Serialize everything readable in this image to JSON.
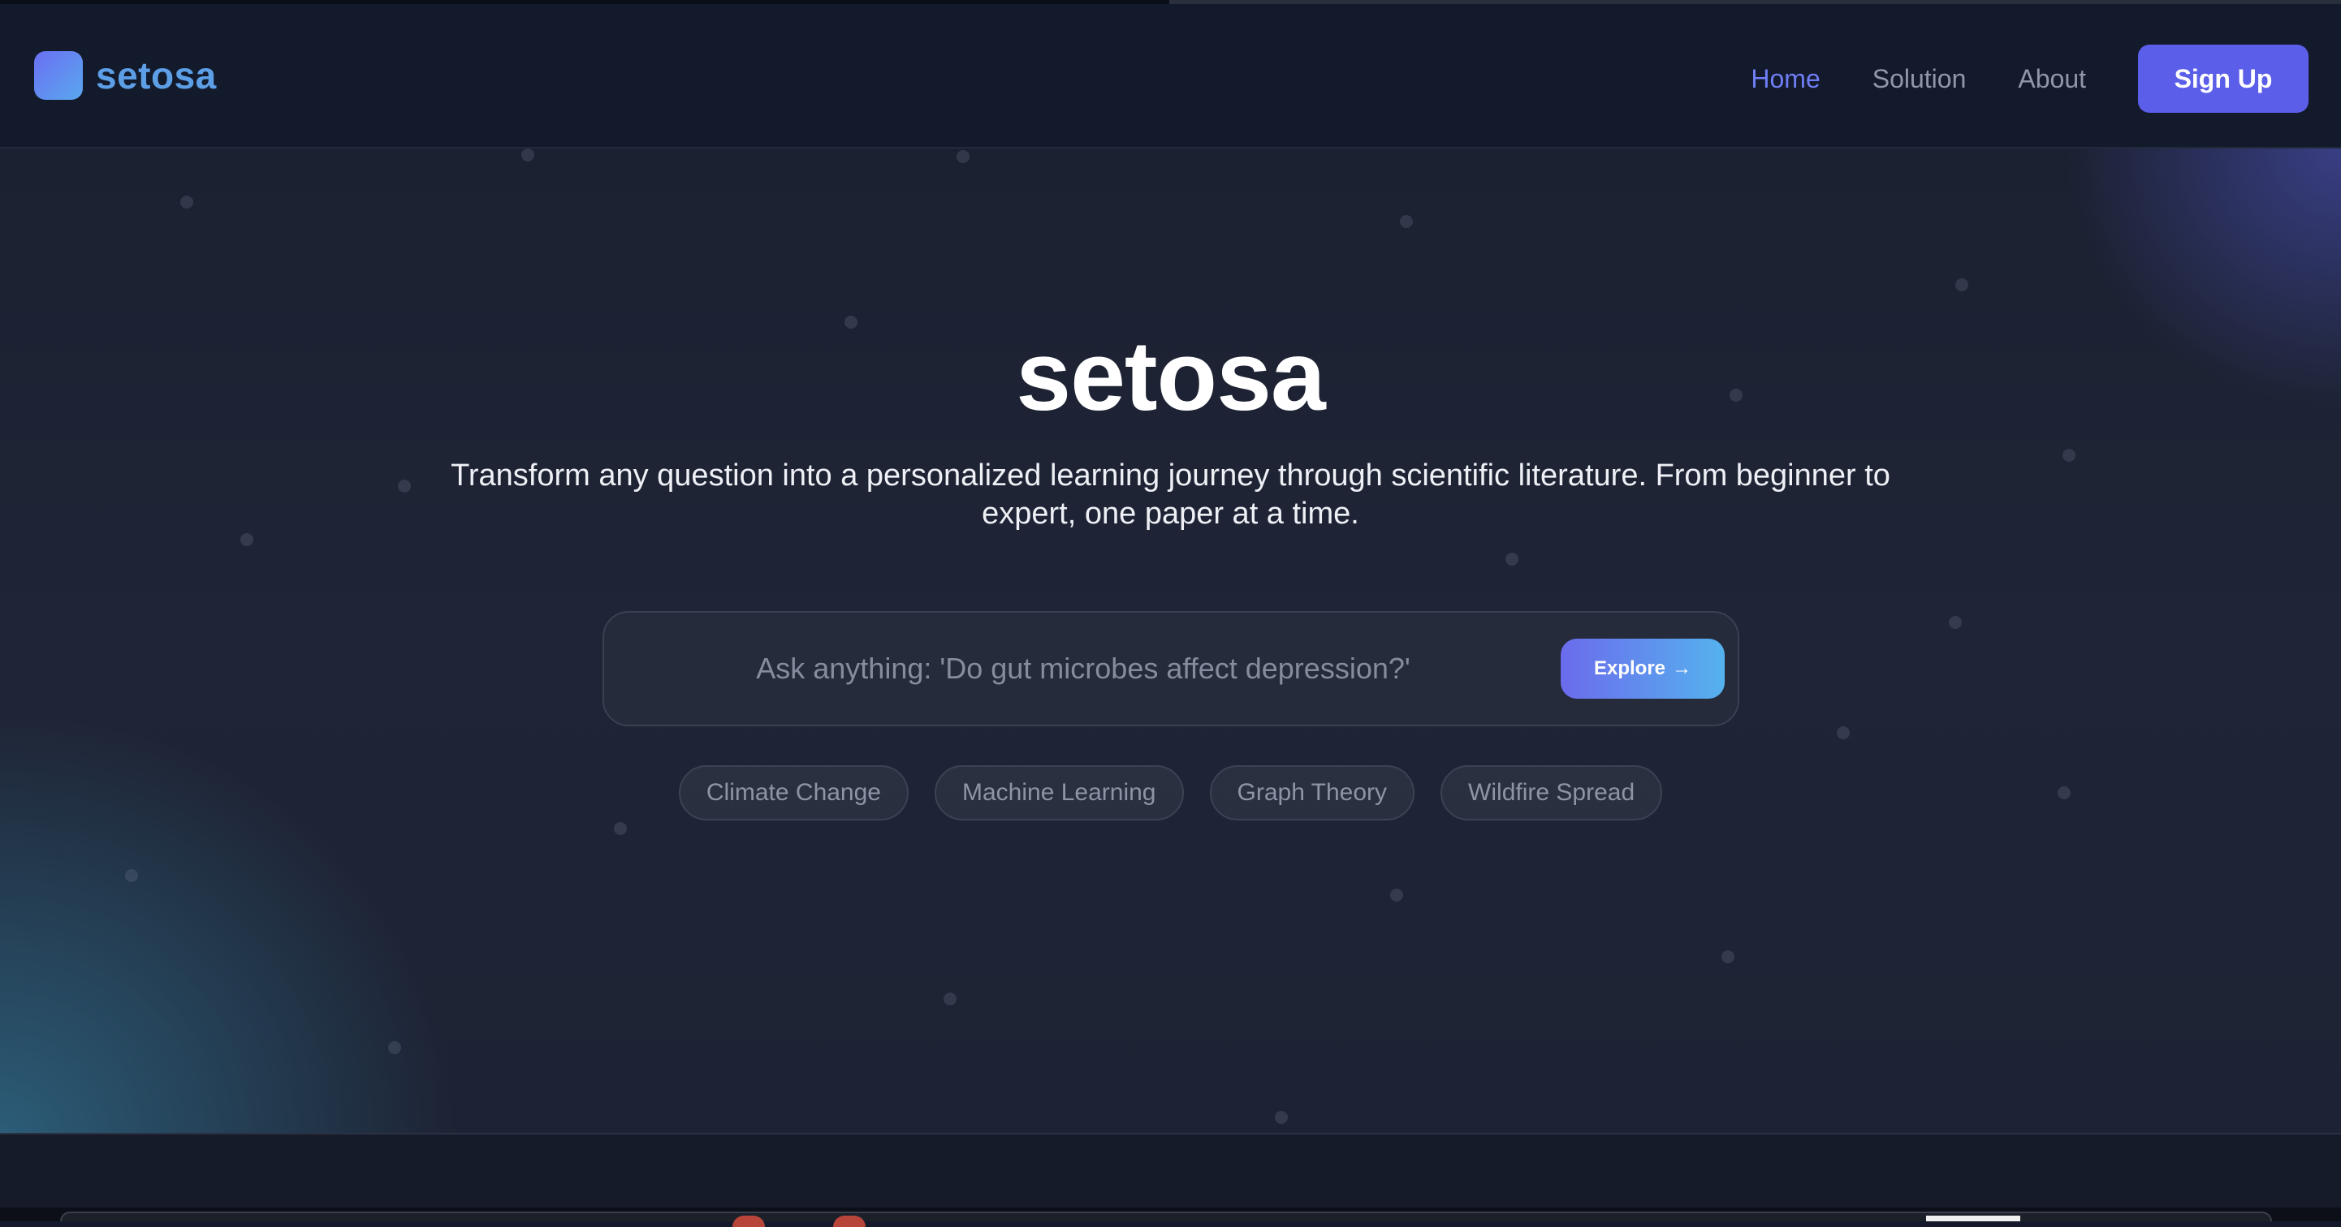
{
  "brand": {
    "name": "setosa"
  },
  "nav": {
    "items": [
      "Home",
      "Solution",
      "About"
    ],
    "active": "Home",
    "signup_label": "Sign Up"
  },
  "hero": {
    "title": "setosa",
    "subtitle": "Transform any question into a personalized learning journey through scientific literature. From beginner to expert, one paper at a time.",
    "search_placeholder": "Ask anything: 'Do gut microbes affect depression?'",
    "search_value": "",
    "explore_label": "Explore",
    "explore_icon": "arrow-right-icon",
    "chips": [
      "Climate Change",
      "Machine Learning",
      "Graph Theory",
      "Wildfire Spread"
    ]
  },
  "colors": {
    "accent": "#5b5ee8",
    "brand_text": "#5d9fe7",
    "nav_active": "#6f7ef5",
    "background": "#1b2131"
  }
}
